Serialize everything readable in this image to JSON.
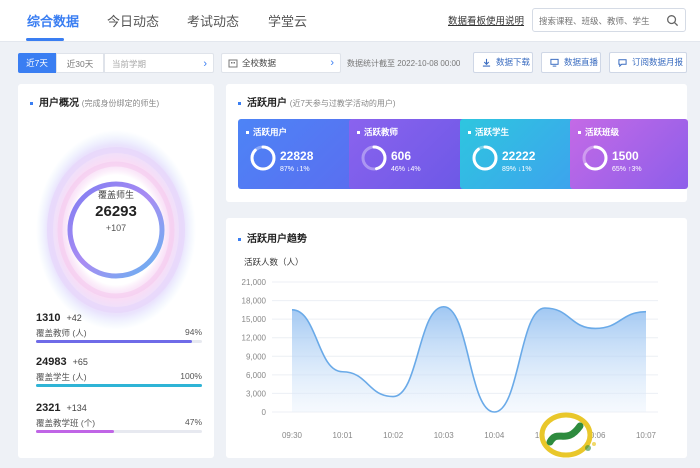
{
  "nav": {
    "tabs": [
      "综合数据",
      "今日动态",
      "考试动态",
      "学堂云"
    ],
    "guide_link": "数据看板使用说明",
    "search_placeholder": "搜索课程、班级、教师、学生"
  },
  "filters": {
    "range_7": "近7天",
    "range_30": "近30天",
    "term": "当前学期",
    "school": "全校数据",
    "stat_date": "数据统计截至 2022-10-08 00:00",
    "buttons": [
      "数据下载",
      "数据直播",
      "订阅数据月报"
    ]
  },
  "overview": {
    "title": "用户概况",
    "subtitle": "(完成身份绑定的师生)",
    "ring_label": "覆盖师生",
    "ring_value": "26293",
    "ring_delta": "+107",
    "metrics": [
      {
        "value": "1310",
        "delta": "+42",
        "label": "覆盖教师 (人)",
        "pct": "94%",
        "fraction": 0.94,
        "color": "#6f6be8"
      },
      {
        "value": "24983",
        "delta": "+65",
        "label": "覆盖学生 (人)",
        "pct": "100%",
        "fraction": 1.0,
        "color": "#2fb4d6"
      },
      {
        "value": "2321",
        "delta": "+134",
        "label": "覆盖教学班 (个)",
        "pct": "47%",
        "fraction": 0.47,
        "color": "#c065e6"
      }
    ]
  },
  "active": {
    "title": "活跃用户",
    "subtitle": "(近7天参与过教学活动的用户)",
    "cards": [
      {
        "title": "活跃用户",
        "value": "22828",
        "meta": "87% ↓1%",
        "fraction": 0.87,
        "from": "#4d84f6",
        "to": "#5a6ef0"
      },
      {
        "title": "活跃教师",
        "value": "606",
        "meta": "46% ↓4%",
        "fraction": 0.46,
        "from": "#8a63ee",
        "to": "#6c58e6"
      },
      {
        "title": "活跃学生",
        "value": "22222",
        "meta": "89% ↓1%",
        "fraction": 0.89,
        "from": "#2ec6df",
        "to": "#3da2ee"
      },
      {
        "title": "活跃班级",
        "value": "1500",
        "meta": "65% ↑3%",
        "fraction": 0.65,
        "from": "#c46ae6",
        "to": "#8d5eea"
      }
    ]
  },
  "trend": {
    "title": "活跃用户趋势",
    "ylabel": "活跃人数（人）"
  },
  "chart_data": {
    "type": "area",
    "title": "活跃用户趋势",
    "ylabel": "活跃人数（人）",
    "x": [
      "09:30",
      "10:01",
      "10:02",
      "10:03",
      "10:04",
      "10:05",
      "10:06",
      "10:07"
    ],
    "y_ticks": [
      "0",
      "3,000",
      "6,000",
      "9,000",
      "12,000",
      "15,000",
      "18,000",
      "21,000"
    ],
    "values": [
      16500,
      6500,
      2500,
      17000,
      0,
      16800,
      13500,
      16200
    ],
    "ylim": [
      0,
      21000
    ],
    "grid": true,
    "color": "#6aaae8"
  }
}
